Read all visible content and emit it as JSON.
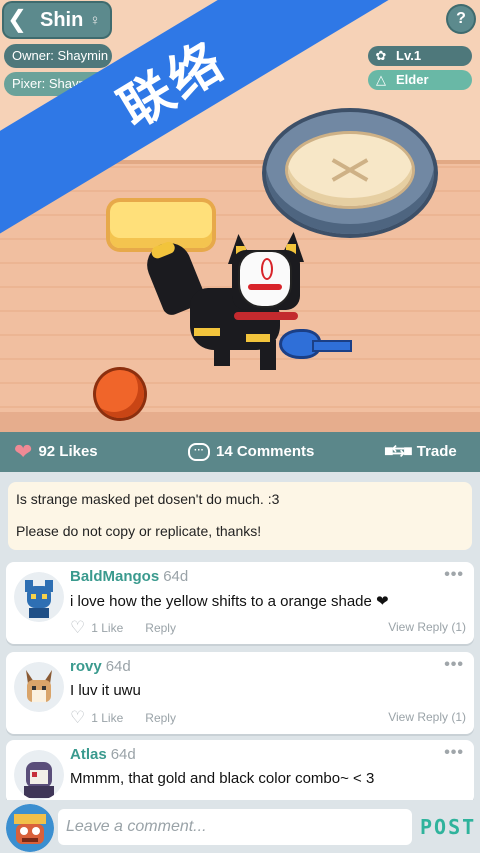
{
  "header": {
    "back_icon": "chevron-left-icon",
    "pet_name": "Shin",
    "gender_icon": "female-icon",
    "owner": "Owner: Shaymin",
    "pixer": "Pixer: Shaymin",
    "help_label": "?",
    "level": "Lv.1",
    "rank": "Elder"
  },
  "banner": {
    "text": "联络"
  },
  "stats": {
    "likes": "92 Likes",
    "comments": "14 Comments",
    "trade": "Trade"
  },
  "description": {
    "line1": "Is strange masked pet dosen't do much. :3",
    "line2": "Please do not copy or replicate, thanks!"
  },
  "comments": [
    {
      "user": "BaldMangos",
      "age": "64d",
      "text": "i love how the yellow shifts to a orange shade ❤",
      "likes": "1 Like",
      "reply": "Reply",
      "view_reply": "View Reply (1)"
    },
    {
      "user": "rovy",
      "age": "64d",
      "text": "I luv it uwu",
      "likes": "1 Like",
      "reply": "Reply",
      "view_reply": "View Reply (1)"
    },
    {
      "user": "Atlas",
      "age": "64d",
      "text": "Mmmm, that gold and black color combo~ < 3"
    }
  ],
  "composer": {
    "placeholder": "Leave a comment...",
    "post_label": "POST"
  },
  "colors": {
    "accent": "#5b878a",
    "banner": "#2f78e6",
    "username": "#3a9a8e",
    "post": "#2fb39c"
  }
}
